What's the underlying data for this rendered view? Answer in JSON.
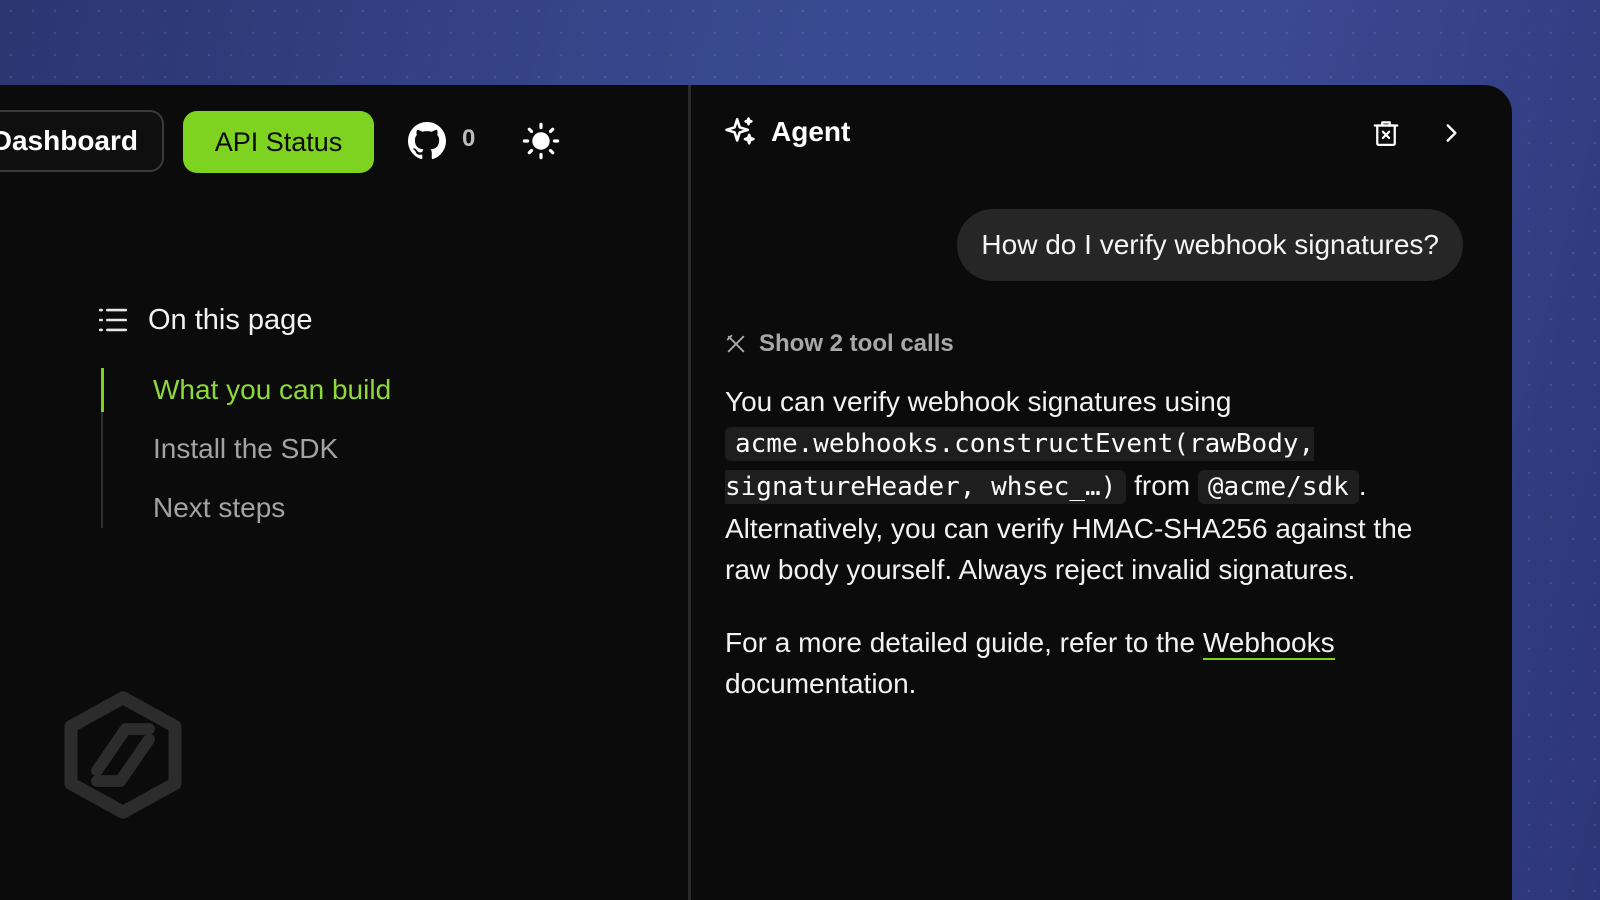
{
  "header": {
    "dashboard_label": "Dashboard",
    "api_status_label": "API Status",
    "github_icon": "github-icon",
    "github_stars": "0",
    "theme_icon": "sun-icon"
  },
  "toc": {
    "icon": "list-icon",
    "title": "On this page",
    "items": [
      {
        "label": "What you can build",
        "active": true
      },
      {
        "label": "Install the SDK",
        "active": false
      },
      {
        "label": "Next steps",
        "active": false
      }
    ]
  },
  "agent": {
    "icon": "sparkles-icon",
    "title": "Agent",
    "clear_icon": "trash-icon",
    "collapse_icon": "chevron-right-icon",
    "user_message": "How do I verify webhook signatures?",
    "tool_calls_label": "Show 2 tool calls",
    "answer": {
      "p1_text1": "You can verify webhook signatures using",
      "p1_code1": "acme.webhooks.constructEvent(rawBody, signatureHeader, whsec_…)",
      "p1_text2": "from",
      "p1_code2": "@acme/sdk",
      "p1_text3": ". Alternatively, you can verify HMAC-SHA256 against the raw body yourself. Always reject invalid signatures.",
      "p2_text1": "For a more detailed guide, refer to the",
      "p2_link": "Webhooks",
      "p2_text2": "documentation."
    }
  },
  "colors": {
    "accent": "#7ed321",
    "panel": "#0b0b0b",
    "bubble": "#262626"
  }
}
